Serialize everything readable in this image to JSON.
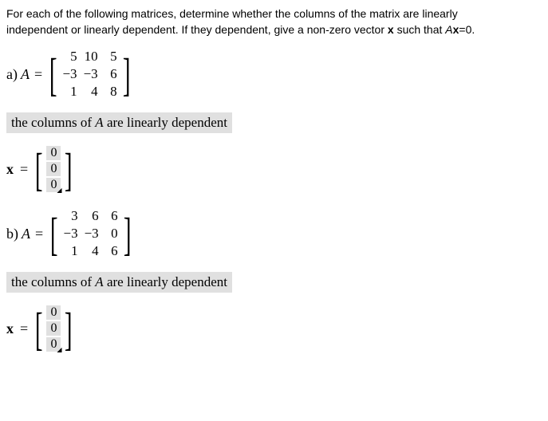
{
  "instructions": {
    "line1": "For each of the following matrices, determine whether the columns of the matrix are linearly",
    "line2_prefix": "independent or linearly dependent. If they dependent, give a non-zero vector ",
    "line2_x": "x",
    "line2_mid": " such that ",
    "line2_A": "A",
    "line2_suffix": "=0."
  },
  "problems": [
    {
      "label": "a) ",
      "var": "A",
      "eq": " = ",
      "matrix": [
        "5",
        "10",
        "5",
        "−3",
        "−3",
        "6",
        "1",
        "4",
        "8"
      ],
      "answer_prefix": "the columns of ",
      "answer_A": "A",
      "answer_suffix": " are linearly dependent",
      "x_label": "x",
      "x_eq": " = ",
      "vector": [
        "0",
        "0",
        "0"
      ]
    },
    {
      "label": "b) ",
      "var": "A",
      "eq": " = ",
      "matrix": [
        "3",
        "6",
        "6",
        "−3",
        "−3",
        "0",
        "1",
        "4",
        "6"
      ],
      "answer_prefix": "the columns of ",
      "answer_A": "A",
      "answer_suffix": " are linearly dependent",
      "x_label": "x",
      "x_eq": " = ",
      "vector": [
        "0",
        "0",
        "0"
      ]
    }
  ]
}
